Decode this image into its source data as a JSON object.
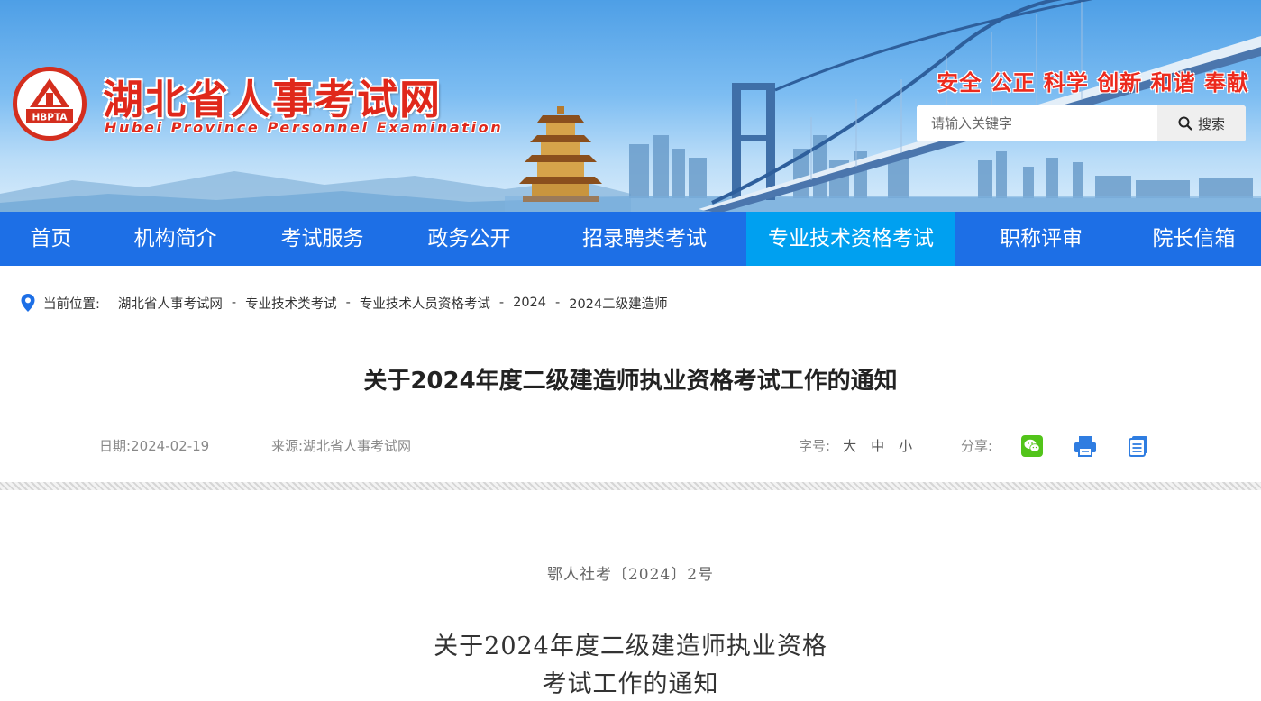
{
  "header": {
    "site_name_cn": "湖北省人事考试网",
    "site_name_en": "Hubei Province Personnel Examination",
    "logo_text": "HBPTA",
    "slogan": "安全 公正 科学 创新 和谐 奉献",
    "search": {
      "placeholder": "请输入关键字",
      "button_label": "搜索"
    }
  },
  "nav": {
    "items": [
      {
        "label": "首页"
      },
      {
        "label": "机构简介"
      },
      {
        "label": "考试服务"
      },
      {
        "label": "政务公开"
      },
      {
        "label": "招录聘类考试"
      },
      {
        "label": "专业技术资格考试",
        "active": true
      },
      {
        "label": "职称评审"
      },
      {
        "label": "院长信箱"
      }
    ]
  },
  "breadcrumb": {
    "label": "当前位置:",
    "items": [
      "湖北省人事考试网",
      "专业技术类考试",
      "专业技术人员资格考试",
      "2024",
      "2024二级建造师"
    ],
    "separator": "-"
  },
  "article": {
    "title": "关于2024年度二级建造师执业资格考试工作的通知",
    "date_text": "日期:2024-02-19",
    "source_text": "来源:湖北省人事考试网",
    "font_size": {
      "label": "字号:",
      "large": "大",
      "medium": "中",
      "small": "小"
    },
    "share_label": "分享:",
    "doc_number": "鄂人社考〔2024〕2号",
    "doc_title_line1": "关于2024年度二级建造师执业资格",
    "doc_title_line2": "考试工作的通知"
  },
  "colors": {
    "nav_bg": "#1d6fe6",
    "nav_active_bg": "#00a0f0",
    "brand_red": "#e0281b",
    "wechat_green": "#52c41a",
    "icon_blue": "#2f7de1"
  },
  "icons": [
    "location-pin-icon",
    "search-icon",
    "wechat-icon",
    "print-icon",
    "copy-icon"
  ]
}
